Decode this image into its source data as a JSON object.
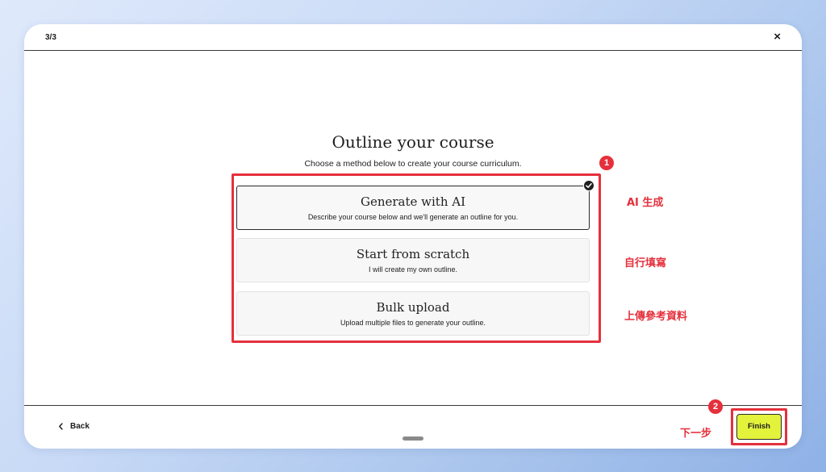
{
  "header": {
    "step": "3/3",
    "close_icon": "×"
  },
  "main": {
    "title": "Outline your course",
    "subtitle": "Choose a method below to create your course curriculum."
  },
  "options": [
    {
      "title": "Generate with AI",
      "description": "Describe your course below and we'll generate an outline for you.",
      "selected": true
    },
    {
      "title": "Start from scratch",
      "description": "I will create my own outline.",
      "selected": false
    },
    {
      "title": "Bulk upload",
      "description": "Upload multiple files to generate your outline.",
      "selected": false
    }
  ],
  "annotations": {
    "badge_1": "1",
    "badge_2": "2",
    "labels": [
      "AI 生成",
      "自行填寫",
      "上傳參考資料"
    ],
    "next_step": "下一步",
    "color": "#e5303c"
  },
  "footer": {
    "back_label": "Back",
    "finish_label": "Finish",
    "finish_color": "#e3f23b"
  }
}
